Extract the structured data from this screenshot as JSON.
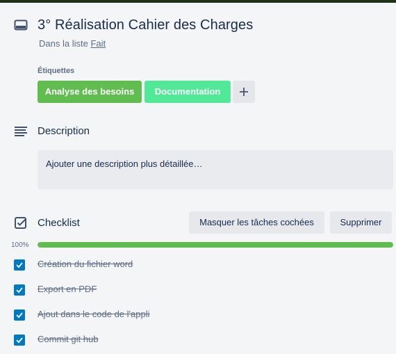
{
  "card": {
    "title": "3° Réalisation Cahier des Charges",
    "in_list_prefix": "Dans la liste",
    "list_name": "Fait"
  },
  "labels": {
    "heading": "Étiquettes",
    "items": [
      {
        "text": "Analyse des besoins",
        "color": "#61bd4f"
      },
      {
        "text": "Documentation",
        "color": "#51e898"
      }
    ],
    "add_icon": "plus-icon"
  },
  "description": {
    "heading": "Description",
    "placeholder": "Ajouter une description plus détaillée…"
  },
  "checklist": {
    "heading": "Checklist",
    "hide_checked_label": "Masquer les tâches cochées",
    "delete_label": "Supprimer",
    "progress_text": "100%",
    "progress_fraction": 1.0,
    "items": [
      {
        "text": "Création du fichier word",
        "checked": true
      },
      {
        "text": "Export en PDF",
        "checked": true
      },
      {
        "text": "Ajout dans le code de l'appli",
        "checked": true
      },
      {
        "text": "Commit git hub",
        "checked": true
      }
    ]
  },
  "colors": {
    "checkbox": "#0079bf",
    "progress": "#61bd4f"
  }
}
